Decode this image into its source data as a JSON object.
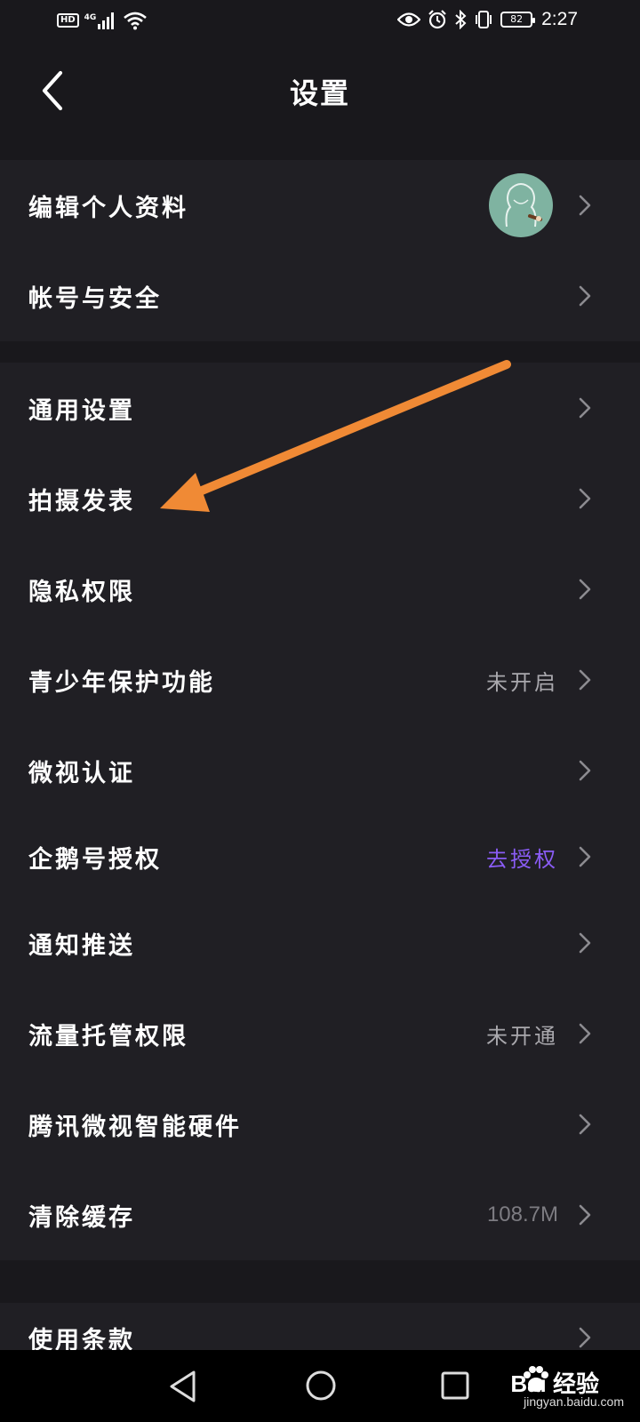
{
  "status_bar": {
    "hd": "HD",
    "network": "4G",
    "battery": "82",
    "time": "2:27"
  },
  "header": {
    "title": "设置"
  },
  "groups": [
    {
      "items": [
        {
          "label": "编辑个人资料",
          "icon": "avatar"
        },
        {
          "label": "帐号与安全"
        }
      ]
    },
    {
      "items": [
        {
          "label": "通用设置"
        },
        {
          "label": "拍摄发表"
        },
        {
          "label": "隐私权限"
        },
        {
          "label": "青少年保护功能",
          "value": "未开启"
        },
        {
          "label": "微视认证"
        },
        {
          "label": "企鹅号授权",
          "value": "去授权"
        },
        {
          "label": "通知推送"
        },
        {
          "label": "流量托管权限",
          "value": "未开通"
        },
        {
          "label": "腾讯微视智能硬件"
        },
        {
          "label": "清除缓存",
          "value": "108.7M"
        }
      ]
    },
    {
      "items": [
        {
          "label": "使用条款"
        }
      ]
    }
  ],
  "colors": {
    "background": "#19181c",
    "card": "#201f24",
    "accent": "#8a5cf5",
    "secondary_text": "#a9a8ad",
    "annotation_arrow": "#f08a35"
  },
  "watermark": {
    "brand": "Bai 经验",
    "url": "jingyan.baidu.com"
  }
}
